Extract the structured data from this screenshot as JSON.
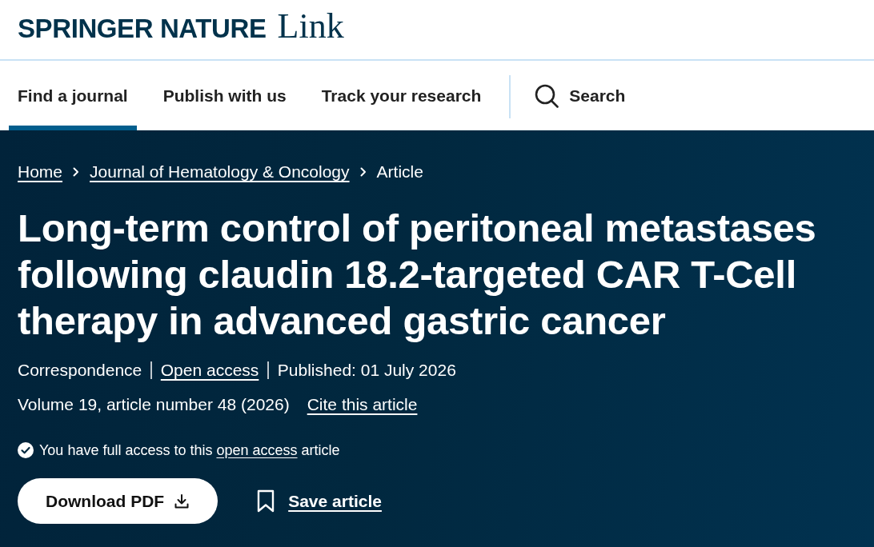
{
  "header": {
    "logo": {
      "brand": "SPRINGER NATURE",
      "product": "Link"
    }
  },
  "nav": {
    "items": [
      {
        "label": "Find a journal",
        "selected": true
      },
      {
        "label": "Publish with us",
        "selected": false
      },
      {
        "label": "Track your research",
        "selected": false
      }
    ],
    "search": {
      "label": "Search"
    }
  },
  "breadcrumbs": [
    {
      "label": "Home",
      "kind": "link"
    },
    {
      "label": "Journal of Hematology & Oncology",
      "kind": "link"
    },
    {
      "label": "Article",
      "kind": "current"
    }
  ],
  "article": {
    "title": "Long-term control of peritoneal metastases following claudin 18.2-targeted CAR T-Cell therapy in advanced gastric cancer",
    "meta": [
      {
        "text": "Correspondence",
        "kind": "text"
      },
      {
        "text": "Open access",
        "kind": "link"
      },
      {
        "text": "Published: 01 July 2026",
        "kind": "text"
      }
    ],
    "citation": "Volume 19, article number 48 (2026)",
    "cite_link": "Cite this article",
    "access_notice": {
      "before": "You have full access to this",
      "link": "open access",
      "after": "article"
    },
    "actions": {
      "download": "Download PDF",
      "save": "Save article"
    }
  }
}
